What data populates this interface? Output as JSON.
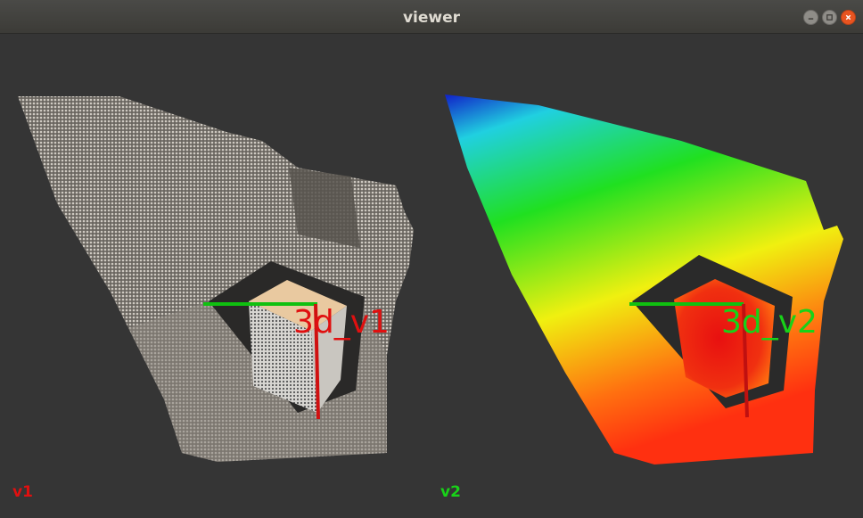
{
  "window": {
    "title": "viewer"
  },
  "viewports": {
    "v1": {
      "label": "v1",
      "coord_label": "3d_v1",
      "label_color": "#e01010"
    },
    "v2": {
      "label": "v2",
      "coord_label": "3d_v2",
      "label_color": "#18d218"
    }
  },
  "colors": {
    "background": "#353535",
    "axis_x": "#d01010",
    "axis_y": "#10c010"
  }
}
